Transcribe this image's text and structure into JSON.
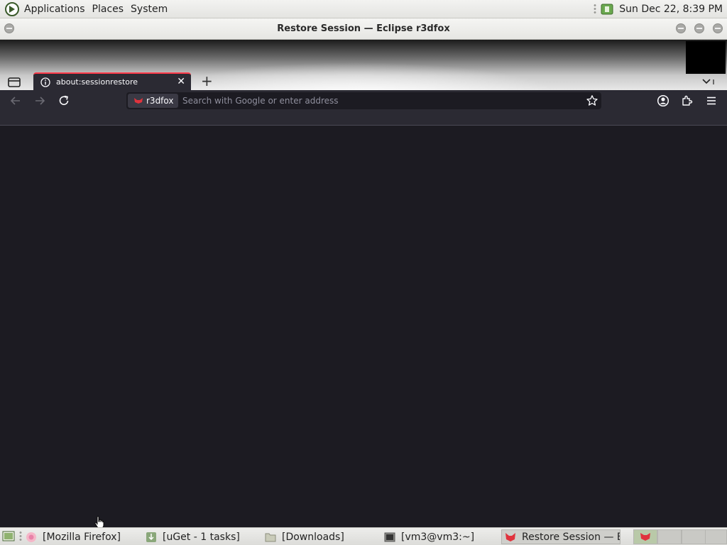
{
  "top_panel": {
    "menus": [
      "Applications",
      "Places",
      "System"
    ],
    "clock": "Sun Dec 22,  8:39 PM"
  },
  "window": {
    "title": "Restore Session — Eclipse r3dfox"
  },
  "browser": {
    "tab": {
      "title": "about:sessionrestore",
      "close": "✕"
    },
    "new_tab": "+",
    "urlbar": {
      "identity_label": "r3dfox",
      "placeholder": "Search with Google or enter address",
      "value": ""
    },
    "accent_color": "#ff3b4a",
    "background_color": "#1c1b22"
  },
  "taskbar": {
    "tasks": [
      {
        "label": "[Mozilla Firefox]",
        "icon": "firefox-icon"
      },
      {
        "label": "[uGet - 1 tasks]",
        "icon": "uget-icon"
      },
      {
        "label": "[Downloads]",
        "icon": "folder-icon"
      },
      {
        "label": "[vm3@vm3:~]",
        "icon": "terminal-icon"
      },
      {
        "label": "Restore Session — E...",
        "icon": "r3dfox-icon"
      }
    ]
  }
}
